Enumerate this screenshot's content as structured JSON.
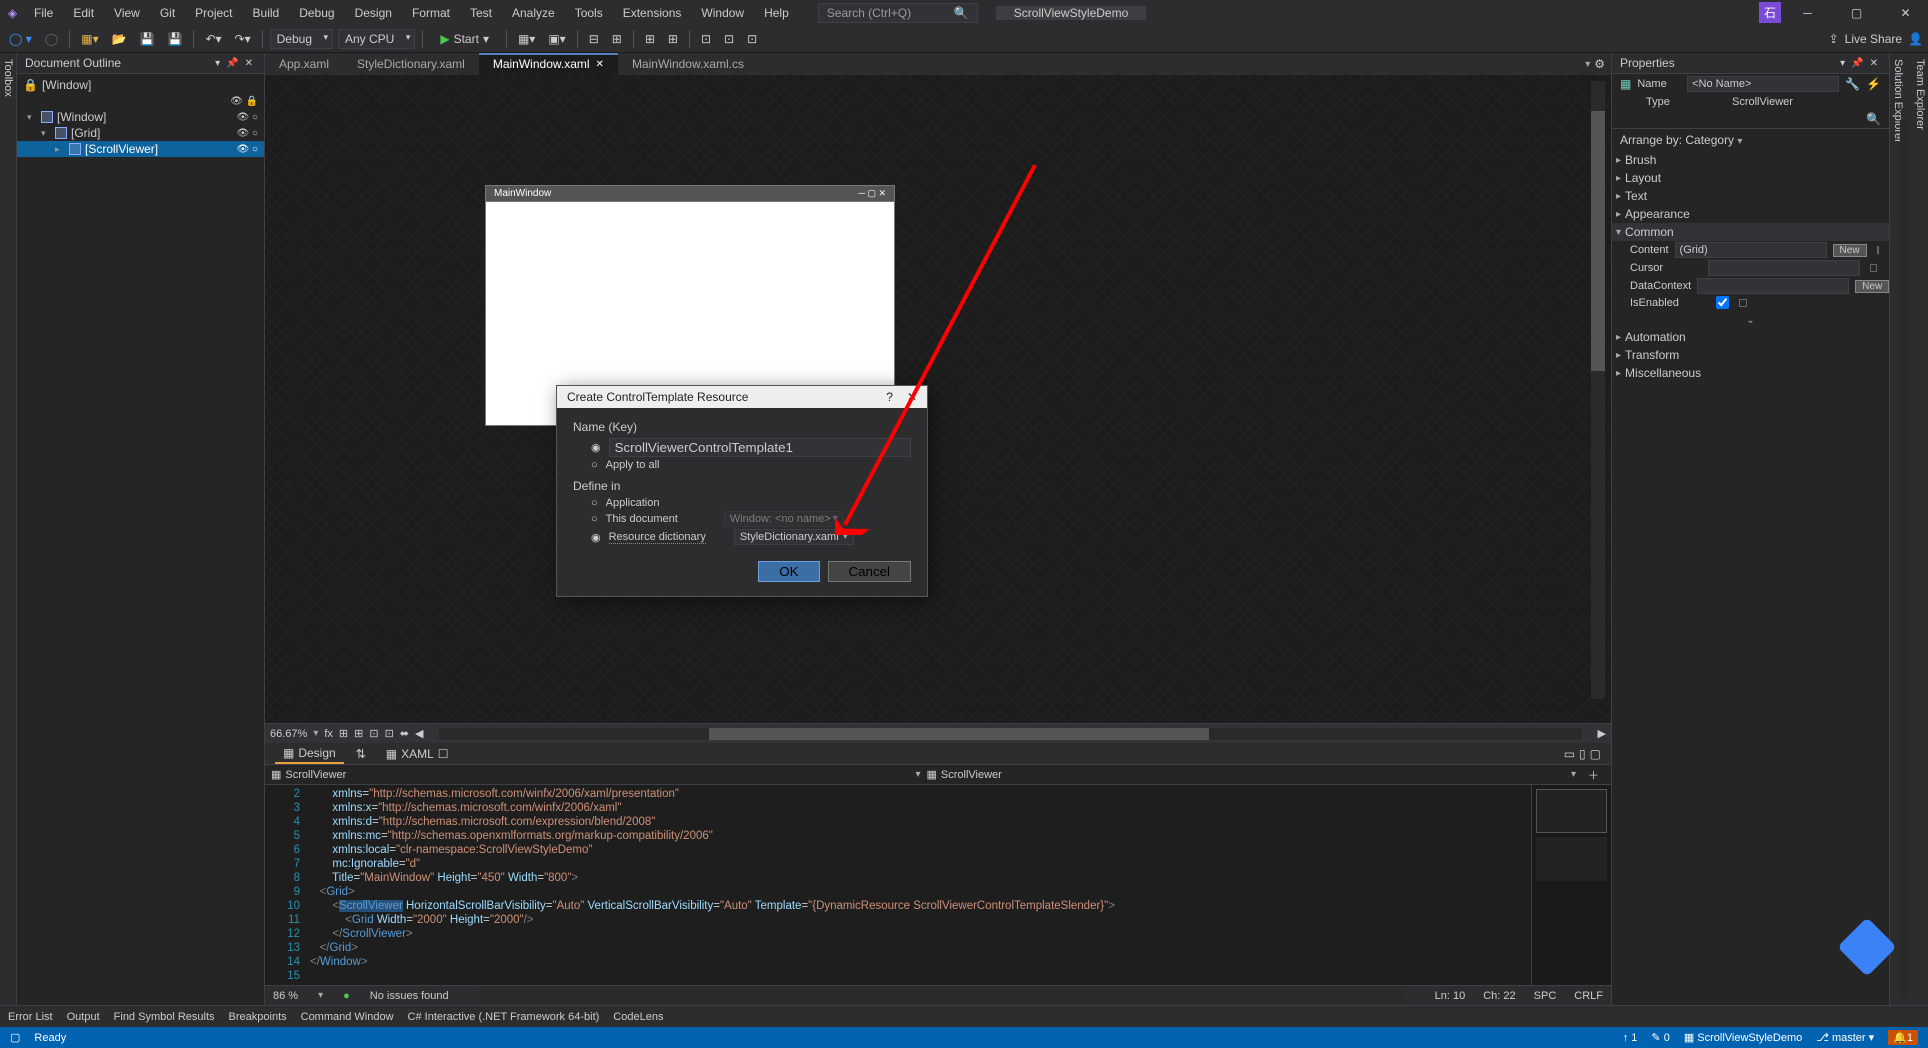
{
  "title_menu": [
    "File",
    "Edit",
    "View",
    "Git",
    "Project",
    "Build",
    "Debug",
    "Design",
    "Format",
    "Test",
    "Analyze",
    "Tools",
    "Extensions",
    "Window",
    "Help"
  ],
  "search_placeholder": "Search (Ctrl+Q)",
  "solution_name": "ScrollViewStyleDemo",
  "live_share": "Live Share",
  "toolbar": {
    "config": "Debug",
    "platform": "Any CPU",
    "start": "Start"
  },
  "side_tabs": {
    "left": "Toolbox",
    "right_top": "Solution Explorer",
    "right_bottom": "Team Explorer"
  },
  "outline": {
    "title": "Document Outline",
    "root": "[Window]",
    "tree": [
      {
        "indent": 0,
        "expand": "▾",
        "label": "[Window]"
      },
      {
        "indent": 1,
        "expand": "▾",
        "label": "[Grid]"
      },
      {
        "indent": 2,
        "expand": "▸",
        "label": "[ScrollViewer]",
        "selected": true
      }
    ]
  },
  "tabs": [
    {
      "label": "App.xaml",
      "active": false
    },
    {
      "label": "StyleDictionary.xaml",
      "active": false
    },
    {
      "label": "MainWindow.xaml",
      "active": true,
      "x": true
    },
    {
      "label": "MainWindow.xaml.cs",
      "active": false
    }
  ],
  "designer": {
    "win_title": "MainWindow",
    "zoom": "66.67%"
  },
  "split": {
    "design": "Design",
    "xaml": "XAML"
  },
  "breadcrumb": {
    "left": "ScrollViewer",
    "right": "ScrollViewer"
  },
  "code": {
    "lines": [
      2,
      3,
      4,
      5,
      6,
      7,
      8,
      9,
      10,
      11,
      12,
      13,
      14,
      15
    ],
    "text": "       xmlns=\"http://schemas.microsoft.com/winfx/2006/xaml/presentation\"\n       xmlns:x=\"http://schemas.microsoft.com/winfx/2006/xaml\"\n       xmlns:d=\"http://schemas.microsoft.com/expression/blend/2008\"\n       xmlns:mc=\"http://schemas.openxmlformats.org/markup-compatibility/2006\"\n       xmlns:local=\"clr-namespace:ScrollViewStyleDemo\"\n       mc:Ignorable=\"d\"\n       Title=\"MainWindow\" Height=\"450\" Width=\"800\">\n   <Grid>\n       <ScrollViewer HorizontalScrollBarVisibility=\"Auto\" VerticalScrollBarVisibility=\"Auto\" Template=\"{DynamicResource ScrollViewerControlTemplateSlender}\">\n           <Grid Width=\"2000\" Height=\"2000\"/>\n       </ScrollViewer>\n   </Grid>\n</Window>\n"
  },
  "code_status": {
    "pct": "86 %",
    "issues": "No issues found",
    "ln": "Ln: 10",
    "ch": "Ch: 22",
    "spc": "SPC",
    "enc": "CRLF"
  },
  "props": {
    "title": "Properties",
    "name_label": "Name",
    "name_value": "<No Name>",
    "type_label": "Type",
    "type_value": "ScrollViewer",
    "arrange": "Arrange by: Category",
    "groups": [
      "Brush",
      "Layout",
      "Text",
      "Appearance"
    ],
    "common_label": "Common",
    "common": [
      {
        "label": "Content",
        "value": "(Grid)",
        "new": true
      },
      {
        "label": "Cursor",
        "value": ""
      },
      {
        "label": "DataContext",
        "value": "",
        "new": true
      },
      {
        "label": "IsEnabled",
        "checked": true
      }
    ],
    "groups2": [
      "Automation",
      "Transform",
      "Miscellaneous"
    ]
  },
  "bottom_tabs": [
    "Error List",
    "Output",
    "Find Symbol Results",
    "Breakpoints",
    "Command Window",
    "C# Interactive (.NET Framework 64-bit)",
    "CodeLens"
  ],
  "status": {
    "ready": "Ready",
    "up": "1",
    "edits": "0",
    "solution": "ScrollViewStyleDemo",
    "branch": "master",
    "bell": "1"
  },
  "dialog": {
    "title": "Create ControlTemplate Resource",
    "name_label": "Name (Key)",
    "template_name": "ScrollViewerControlTemplate1",
    "apply_all": "Apply to all",
    "define_label": "Define in",
    "r_app": "Application",
    "r_doc": "This document",
    "r_doc_value": "Window: <no name>",
    "r_rd": "Resource dictionary",
    "r_rd_value": "StyleDictionary.xaml",
    "ok": "OK",
    "cancel": "Cancel"
  }
}
